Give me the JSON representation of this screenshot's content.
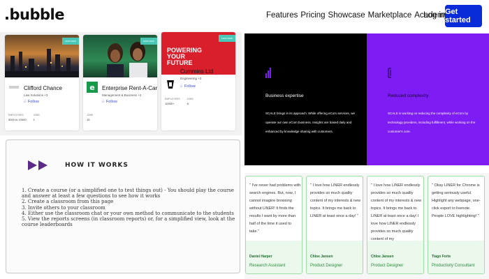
{
  "header": {
    "logo": ".bubble",
    "nav": [
      "Features",
      "Pricing",
      "Showcase",
      "Marketplace",
      "Academy"
    ],
    "login": "Log in",
    "cta": "Get started",
    "cta_color": "#0a2bd8"
  },
  "showcase": {
    "cards": [
      {
        "tag": "FEATURED",
        "name": "Clifford Chance",
        "category": "Law Solutions +3",
        "follow": "Follow",
        "employees_label": "EMPLOYEES",
        "employees": "5000 to 10000",
        "jobs_label": "JOBS",
        "jobs": "1"
      },
      {
        "tag": "FEATURED",
        "name": "Enterprise Rent-A-Car",
        "category": "Management & Business +2",
        "follow": "Follow",
        "employees_label": "JOBS",
        "employees": "15"
      },
      {
        "tag": "FEATURED",
        "banner": "POWERING YOUR FUTURE",
        "name": "Cummins Ltd",
        "category": "Engineering +3",
        "follow": "Follow",
        "employees_label": "EMPLOYEES",
        "employees": "10000+",
        "jobs_label": "JOBS",
        "jobs": "8"
      }
    ]
  },
  "how": {
    "title": "HOW IT WORKS",
    "icon": "double-play-icon",
    "steps": [
      "1. Create a course (or a simplified one to test things out) - You should play the course and answer at least a few questions to see how it works",
      "2. Create a classroom from this page",
      "3. Invite others to your classroom",
      "4. Either use the classroom chat or your own method to communicate to the students",
      "5. View the reports screens (in classroom reports) or, for a simplified view, look at the course leaderboards"
    ]
  },
  "banner": {
    "left": {
      "title": "Business expertise",
      "body": "SCALE brings in its approach. While offering eCom services, we operate our own eCom business. Insights are based daily and enhanced by knowledge sharing with customers."
    },
    "right": {
      "title": "Reduced complexity",
      "body": "SCALE is working on reducing the complexity of eCom by technology providers, including fulfillment, while working on the customer's core."
    },
    "colors": {
      "left": "#000000",
      "right": "#7e1df3"
    }
  },
  "testimonials": [
    {
      "quote": "\" I've never had problems with search engines. But, now, I cannot imagine browsing without LINER! It finds the results I want by more than half of the time it used to take.\"",
      "name": "Daniel Harper",
      "role": "Research Assistant"
    },
    {
      "quote": "\" I love how LINER endlessly provides so much quality content of my interests & new topics. It brings me back to LINER at least once a day! \"",
      "name": "Chloe Jansen",
      "role": "Product Designer"
    },
    {
      "quote": "\" I love how LINER endlessly provides so much quality content of my interests & new topics. It brings me back to LINER at least once a day! I love how LINER endlessly provides so much quality content of my",
      "name": "Chloe Jansen",
      "role": "Product Designer"
    },
    {
      "quote": "\" Okay LINER for Chrome is getting seriously useful. Highlight any webpage, one-click export to livenote. People LOVE highlighting! \"",
      "name": "Tiago Forte",
      "role": "Productivity Consultant"
    }
  ]
}
